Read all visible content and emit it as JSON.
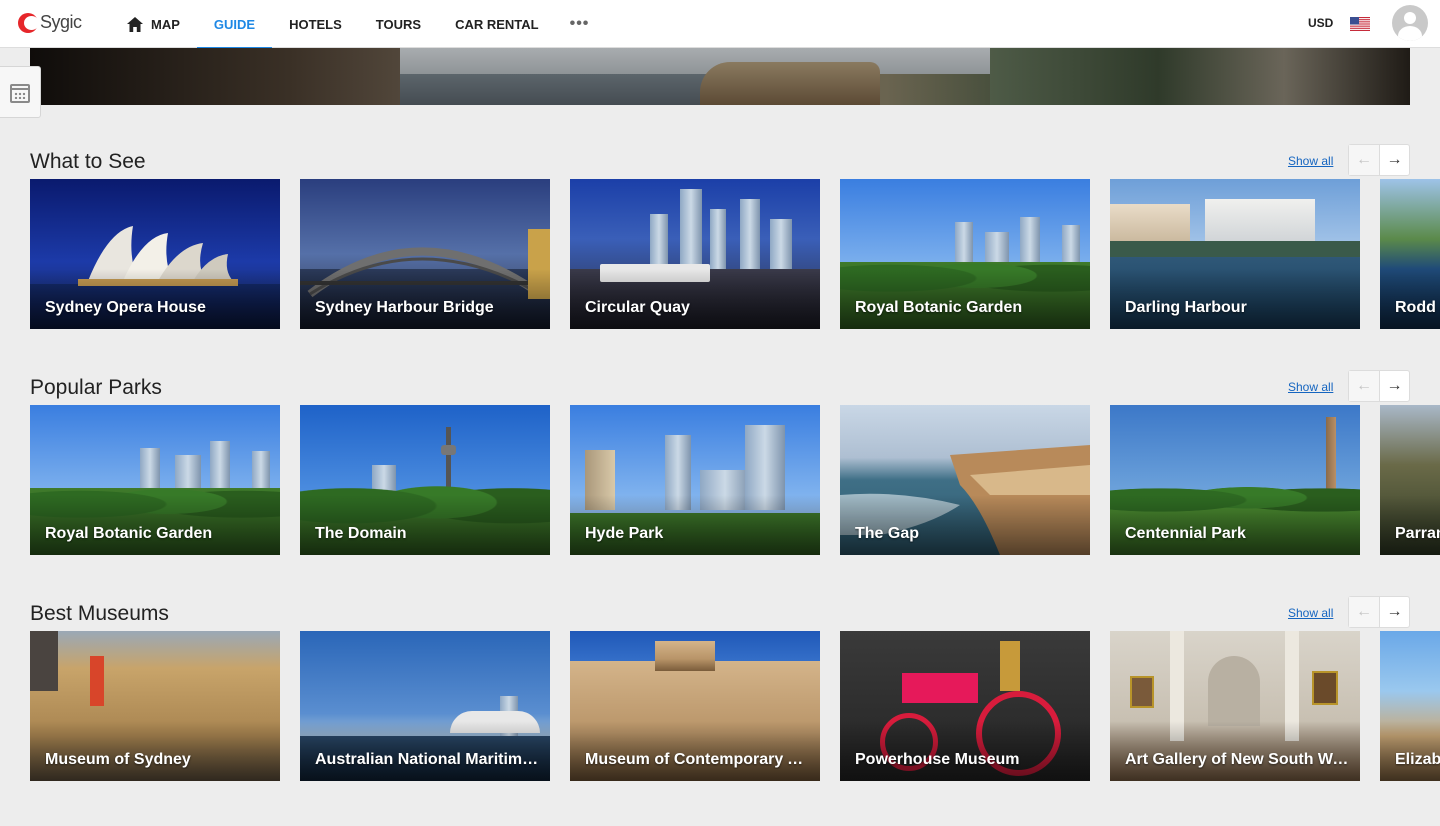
{
  "app": {
    "logo_text": "Sygic",
    "currency": "USD"
  },
  "nav": {
    "items": [
      {
        "label": "MAP",
        "icon": "home-icon",
        "active": false
      },
      {
        "label": "GUIDE",
        "active": true
      },
      {
        "label": "HOTELS",
        "active": false
      },
      {
        "label": "TOURS",
        "active": false
      },
      {
        "label": "CAR RENTAL",
        "active": false
      }
    ],
    "more_label": "•••"
  },
  "colors": {
    "accent": "#1e88e5",
    "brand": "#e6262a",
    "link": "#1565c0"
  },
  "sections": [
    {
      "title": "What to See",
      "show_all": "Show all",
      "prev_arrow": "←",
      "next_arrow": "→",
      "cards": [
        "Sydney Opera House",
        "Sydney Harbour Bridge",
        "Circular Quay",
        "Royal Botanic Garden",
        "Darling Harbour",
        "Rodd I"
      ]
    },
    {
      "title": "Popular Parks",
      "show_all": "Show all",
      "prev_arrow": "←",
      "next_arrow": "→",
      "cards": [
        "Royal Botanic Garden",
        "The Domain",
        "Hyde Park",
        "The Gap",
        "Centennial Park",
        "Parran"
      ]
    },
    {
      "title": "Best Museums",
      "show_all": "Show all",
      "prev_arrow": "←",
      "next_arrow": "→",
      "cards": [
        "Museum of Sydney",
        "Australian National Maritime …",
        "Museum of Contemporary Art",
        "Powerhouse Museum",
        "Art Gallery of New South Wal…",
        "Elizab"
      ]
    }
  ]
}
